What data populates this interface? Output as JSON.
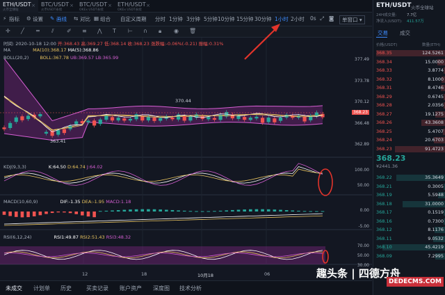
{
  "tabs": [
    {
      "name": "ETH/USDT",
      "sub": "火币全球站"
    },
    {
      "name": "BTC/USDT",
      "sub": "火币USDT永续"
    },
    {
      "name": "BTC/USDT",
      "sub": "OKEx USDT永续"
    },
    {
      "name": "ETH/USDT",
      "sub": "OKEx USDT永续"
    }
  ],
  "toolbar": {
    "indicator": "指标",
    "settings": "设置",
    "line": "画线",
    "compare": "对比",
    "combo": "组合",
    "custom": "自定义周期",
    "intervals": [
      "分时",
      "1分钟",
      "3分钟",
      "5分钟",
      "10分钟",
      "15分钟",
      "30分钟",
      "1小时",
      "2小时"
    ],
    "interval_0s": "0s",
    "layout": "单窗口"
  },
  "ohlc": {
    "label": "时间",
    "date": "2020-10-18 12:00",
    "open": "开:368.43",
    "high": "高:369.27",
    "low": "低:368.14",
    "close": "收:368.23",
    "change": "涨跌幅:-0.06%(-0.21)",
    "amp": "振幅:0.31%"
  },
  "ma": {
    "name": "MA",
    "ma10": "MA(10):368.17",
    "ma5": "MA(5):368.86"
  },
  "boll": {
    "name": "BOLL(20,2)",
    "boll": "BOLL:367.78",
    "ub": "UB:369.57",
    "lb": "LB:365.99"
  },
  "price_labels": {
    "high": "370.44",
    "low": "363.41",
    "last": "368.23"
  },
  "price_axis": [
    "377.49",
    "373.78",
    "370.12",
    "366.48",
    "362.89"
  ],
  "kdj": {
    "name": "KDJ(9,3,3)",
    "k": "K:64.50",
    "d": "D:64.74",
    "j": "J:64.02",
    "axis": [
      "100.00",
      "50.00"
    ]
  },
  "macd": {
    "name": "MACD(10,60,9)",
    "dif": "DIF:-1.35",
    "dea": "DEA:-1.95",
    "macd": "MACD:1.18",
    "axis": [
      "0.00",
      "-5.00"
    ]
  },
  "rsi": {
    "name": "RSI(6,12,24)",
    "r1": "RSI1:49.87",
    "r2": "RSI2:51.43",
    "r3": "RSI3:48.32",
    "axis": [
      "70.00",
      "50.00",
      "30.00"
    ]
  },
  "time_axis": [
    "12",
    "18",
    "10月18",
    "06"
  ],
  "bottom_tabs": [
    "未成交",
    "计划单",
    "历史",
    "买卖记录",
    "账户资产",
    "深度图",
    "技术分析"
  ],
  "right": {
    "pair": "ETH/USDT",
    "exchange": "火币全球站",
    "vol_label": "24H成交量:",
    "vol": "7.7亿",
    "inflow_label": "净流入(USDT):",
    "inflow": "411.57万",
    "tab_trades": "交易",
    "tab_orders": "成交",
    "col_price": "价格(USDT)",
    "col_qty": "数量(ETH)",
    "mid_price": "368.23",
    "mid_cny": "¥2441.36"
  },
  "asks": [
    [
      "368.35",
      "124.5261"
    ],
    [
      "368.34",
      "15.0000"
    ],
    [
      "368.33",
      "3.8774"
    ],
    [
      "368.32",
      "8.1000"
    ],
    [
      "368.31",
      "8.4746"
    ],
    [
      "368.29",
      "0.6745"
    ],
    [
      "368.28",
      "2.0356"
    ],
    [
      "368.27",
      "19.1275"
    ],
    [
      "368.26",
      "43.3608"
    ],
    [
      "368.25",
      "5.4707"
    ],
    [
      "368.24",
      "20.6703"
    ],
    [
      "368.23",
      "91.4723"
    ]
  ],
  "bids": [
    [
      "368.22",
      "35.3649"
    ],
    [
      "368.21",
      "0.3005"
    ],
    [
      "368.19",
      "5.5948"
    ],
    [
      "368.18",
      "31.0000"
    ],
    [
      "368.17",
      "0.1519"
    ],
    [
      "368.16",
      "0.7300"
    ],
    [
      "368.12",
      "8.1176"
    ],
    [
      "368.11",
      "9.0532"
    ],
    [
      "368.10",
      "45.4219"
    ],
    [
      "368.09",
      "7.2995"
    ]
  ],
  "watermark": "趣头条 | 四德方舟",
  "watermark2": "DEDECMS.COM",
  "colors": {
    "up": "#26a69a",
    "down": "#ef5350",
    "accent": "#3d8bfd",
    "ma5": "#ffffff",
    "ma10": "#e8c35f",
    "boll": "#d65fd3"
  }
}
